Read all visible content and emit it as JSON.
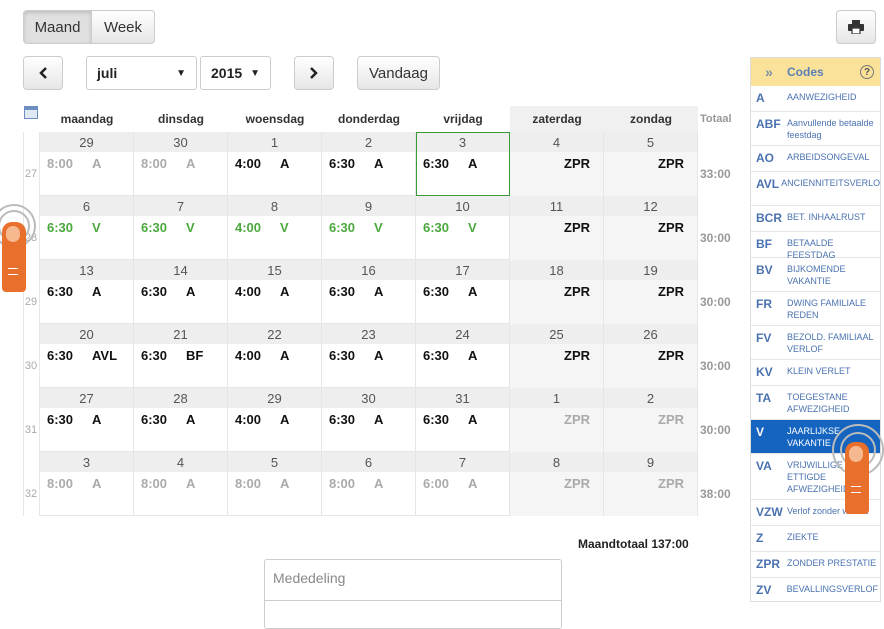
{
  "toolbar": {
    "maand": "Maand",
    "week": "Week",
    "today": "Vandaag",
    "month": "juli",
    "year": "2015"
  },
  "headers": {
    "days": [
      "maandag",
      "dinsdag",
      "woensdag",
      "donderdag",
      "vrijdag",
      "zaterdag",
      "zondag"
    ],
    "total": "Totaal"
  },
  "weeks": [
    {
      "num": "27",
      "total": "33:00",
      "days": [
        {
          "d": "29",
          "t": "8:00",
          "c": "A",
          "s": "grey"
        },
        {
          "d": "30",
          "t": "8:00",
          "c": "A",
          "s": "grey"
        },
        {
          "d": "1",
          "t": "4:00",
          "c": "A",
          "s": ""
        },
        {
          "d": "2",
          "t": "6:30",
          "c": "A",
          "s": ""
        },
        {
          "d": "3",
          "t": "6:30",
          "c": "A",
          "s": "today"
        },
        {
          "d": "4",
          "t": "",
          "c": "ZPR",
          "s": ""
        },
        {
          "d": "5",
          "t": "",
          "c": "ZPR",
          "s": ""
        }
      ]
    },
    {
      "num": "28",
      "total": "30:00",
      "days": [
        {
          "d": "6",
          "t": "6:30",
          "c": "V",
          "s": "green"
        },
        {
          "d": "7",
          "t": "6:30",
          "c": "V",
          "s": "green"
        },
        {
          "d": "8",
          "t": "4:00",
          "c": "V",
          "s": "green"
        },
        {
          "d": "9",
          "t": "6:30",
          "c": "V",
          "s": "green"
        },
        {
          "d": "10",
          "t": "6:30",
          "c": "V",
          "s": "green"
        },
        {
          "d": "11",
          "t": "",
          "c": "ZPR",
          "s": ""
        },
        {
          "d": "12",
          "t": "",
          "c": "ZPR",
          "s": ""
        }
      ]
    },
    {
      "num": "29",
      "total": "30:00",
      "days": [
        {
          "d": "13",
          "t": "6:30",
          "c": "A",
          "s": ""
        },
        {
          "d": "14",
          "t": "6:30",
          "c": "A",
          "s": ""
        },
        {
          "d": "15",
          "t": "4:00",
          "c": "A",
          "s": ""
        },
        {
          "d": "16",
          "t": "6:30",
          "c": "A",
          "s": ""
        },
        {
          "d": "17",
          "t": "6:30",
          "c": "A",
          "s": ""
        },
        {
          "d": "18",
          "t": "",
          "c": "ZPR",
          "s": ""
        },
        {
          "d": "19",
          "t": "",
          "c": "ZPR",
          "s": ""
        }
      ]
    },
    {
      "num": "30",
      "total": "30:00",
      "days": [
        {
          "d": "20",
          "t": "6:30",
          "c": "AVL",
          "s": ""
        },
        {
          "d": "21",
          "t": "6:30",
          "c": "BF",
          "s": ""
        },
        {
          "d": "22",
          "t": "4:00",
          "c": "A",
          "s": ""
        },
        {
          "d": "23",
          "t": "6:30",
          "c": "A",
          "s": ""
        },
        {
          "d": "24",
          "t": "6:30",
          "c": "A",
          "s": ""
        },
        {
          "d": "25",
          "t": "",
          "c": "ZPR",
          "s": ""
        },
        {
          "d": "26",
          "t": "",
          "c": "ZPR",
          "s": ""
        }
      ]
    },
    {
      "num": "31",
      "total": "30:00",
      "days": [
        {
          "d": "27",
          "t": "6:30",
          "c": "A",
          "s": ""
        },
        {
          "d": "28",
          "t": "6:30",
          "c": "A",
          "s": ""
        },
        {
          "d": "29",
          "t": "4:00",
          "c": "A",
          "s": ""
        },
        {
          "d": "30",
          "t": "6:30",
          "c": "A",
          "s": ""
        },
        {
          "d": "31",
          "t": "6:30",
          "c": "A",
          "s": ""
        },
        {
          "d": "1",
          "t": "",
          "c": "ZPR",
          "s": "grey"
        },
        {
          "d": "2",
          "t": "",
          "c": "ZPR",
          "s": "grey"
        }
      ]
    },
    {
      "num": "32",
      "total": "38:00",
      "days": [
        {
          "d": "3",
          "t": "8:00",
          "c": "A",
          "s": "grey"
        },
        {
          "d": "4",
          "t": "8:00",
          "c": "A",
          "s": "grey"
        },
        {
          "d": "5",
          "t": "8:00",
          "c": "A",
          "s": "grey"
        },
        {
          "d": "6",
          "t": "8:00",
          "c": "A",
          "s": "grey"
        },
        {
          "d": "7",
          "t": "6:00",
          "c": "A",
          "s": "grey"
        },
        {
          "d": "8",
          "t": "",
          "c": "ZPR",
          "s": "grey"
        },
        {
          "d": "9",
          "t": "",
          "c": "ZPR",
          "s": "grey"
        }
      ]
    }
  ],
  "month_total": "Maandtotaal 137:00",
  "message_placeholder": "Mededeling",
  "codes": {
    "title": "Codes",
    "chevron": "»",
    "help": "?",
    "items": [
      {
        "k": "A",
        "d": "AANWEZIGHEID"
      },
      {
        "k": "ABF",
        "d": "Aanvullende betaalde feestdag"
      },
      {
        "k": "AO",
        "d": "ARBEIDSONGEVAL"
      },
      {
        "k": "AVL",
        "d": "ANCIENNITEITSVERLOF"
      },
      {
        "k": "BCR",
        "d": "BET. INHAALRUST"
      },
      {
        "k": "BF",
        "d": "BETAALDE FEESTDAG"
      },
      {
        "k": "BV",
        "d": "BIJKOMENDE VAKANTIE"
      },
      {
        "k": "FR",
        "d": "DWING FAMILIALE REDEN"
      },
      {
        "k": "FV",
        "d": "BEZOLD. FAMILIAAL VERLOF"
      },
      {
        "k": "KV",
        "d": "KLEIN VERLET"
      },
      {
        "k": "TA",
        "d": "TOEGESTANE AFWEZIGHEID"
      },
      {
        "k": "V",
        "d": "JAARLIJKSE VAKANTIE",
        "selected": true
      },
      {
        "k": "VA",
        "d": "VRIJWILLIGE ETTIGDE AFWEZIGHEID"
      },
      {
        "k": "VZW",
        "d": "Verlof zonder wedde"
      },
      {
        "k": "Z",
        "d": "ZIEKTE"
      },
      {
        "k": "ZPR",
        "d": "ZONDER PRESTATIE"
      },
      {
        "k": "ZV",
        "d": "BEVALLINGSVERLOF"
      }
    ]
  },
  "icons": {
    "print": "print-icon",
    "prev": "chevron-left-icon",
    "next": "chevron-right-icon",
    "calendar": "calendar-icon",
    "touch": "touch-pointer-icon"
  }
}
